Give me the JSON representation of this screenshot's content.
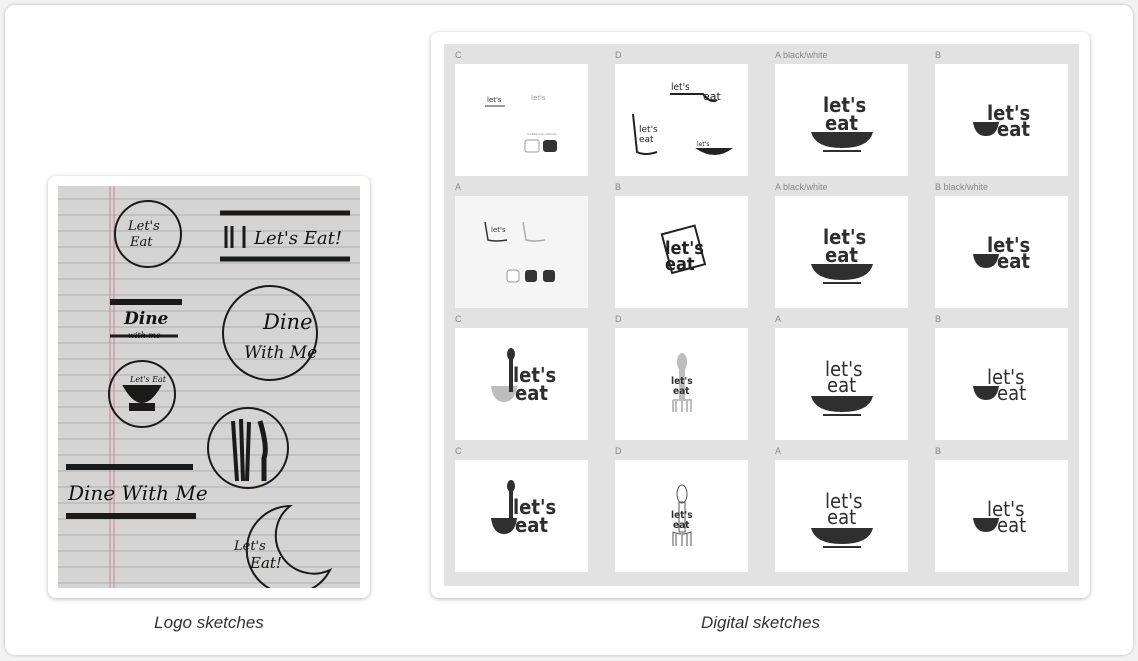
{
  "captions": {
    "left": "Logo sketches",
    "right": "Digital sketches"
  },
  "sketches": {
    "badge": {
      "line1": "Let's",
      "line2": "Eat"
    },
    "banner": "Let's Eat!",
    "dine_title": "Dine",
    "dine_sub": "with me",
    "bowl_word": "Let's Eat",
    "dine_circle": {
      "line1": "Dine",
      "line2": "With Me"
    },
    "dine_banner": "Dine With Me",
    "moon": {
      "line1": "Let's",
      "line2": "Eat!"
    }
  },
  "digital": {
    "labels": [
      [
        "C",
        "D",
        "A black/white",
        "B"
      ],
      [
        "A",
        "B",
        "A black/white",
        "B black/white"
      ],
      [
        "C",
        "D",
        "A",
        "B"
      ],
      [
        "C",
        "D",
        "A",
        "B"
      ]
    ],
    "word_top": "let's",
    "word_bottom": "eat",
    "small_note": "mobile icon options"
  },
  "colors": {
    "ink": "#2f2f2f",
    "paper": "#d9d7d3",
    "gray_tile": "#f5f5f5",
    "grid_bg": "#e2e2e2",
    "fork_gray": "#bdbdbd"
  }
}
